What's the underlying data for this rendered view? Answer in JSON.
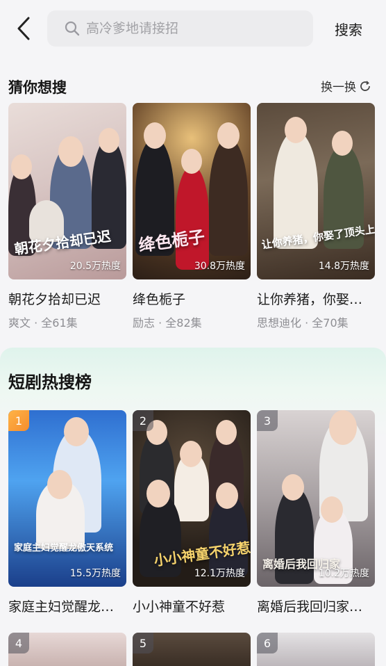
{
  "search": {
    "placeholder": "高冷爹地请接招",
    "button_label": "搜索"
  },
  "guess": {
    "title": "猜你想搜",
    "refresh_label": "换一换",
    "items": [
      {
        "name": "朝花夕拾却已迟",
        "meta": "爽文 · 全61集",
        "heat": "20.5万热度",
        "poster_title": "朝花夕拾却已迟"
      },
      {
        "name": "绛色栀子",
        "meta": "励志 · 全82集",
        "heat": "30.8万热度",
        "poster_title": "绛色栀子"
      },
      {
        "name": "让你养猪，你娶…",
        "meta": "思想迪化 · 全70集",
        "heat": "14.8万热度",
        "poster_title": "让你养猪，你娶了顶头上司"
      }
    ]
  },
  "hot": {
    "title": "短剧热搜榜",
    "items": [
      {
        "rank": "1",
        "name": "家庭主妇觉醒龙…",
        "heat": "15.5万热度",
        "poster_title": "家庭主妇觉醒龙傲天系统"
      },
      {
        "rank": "2",
        "name": "小小神童不好惹",
        "heat": "12.1万热度",
        "poster_title": "小小神童不好惹"
      },
      {
        "rank": "3",
        "name": "离婚后我回归家…",
        "heat": "10.2万热度",
        "poster_title": "离婚后我回归家"
      },
      {
        "rank": "4"
      },
      {
        "rank": "5"
      },
      {
        "rank": "6"
      }
    ]
  }
}
